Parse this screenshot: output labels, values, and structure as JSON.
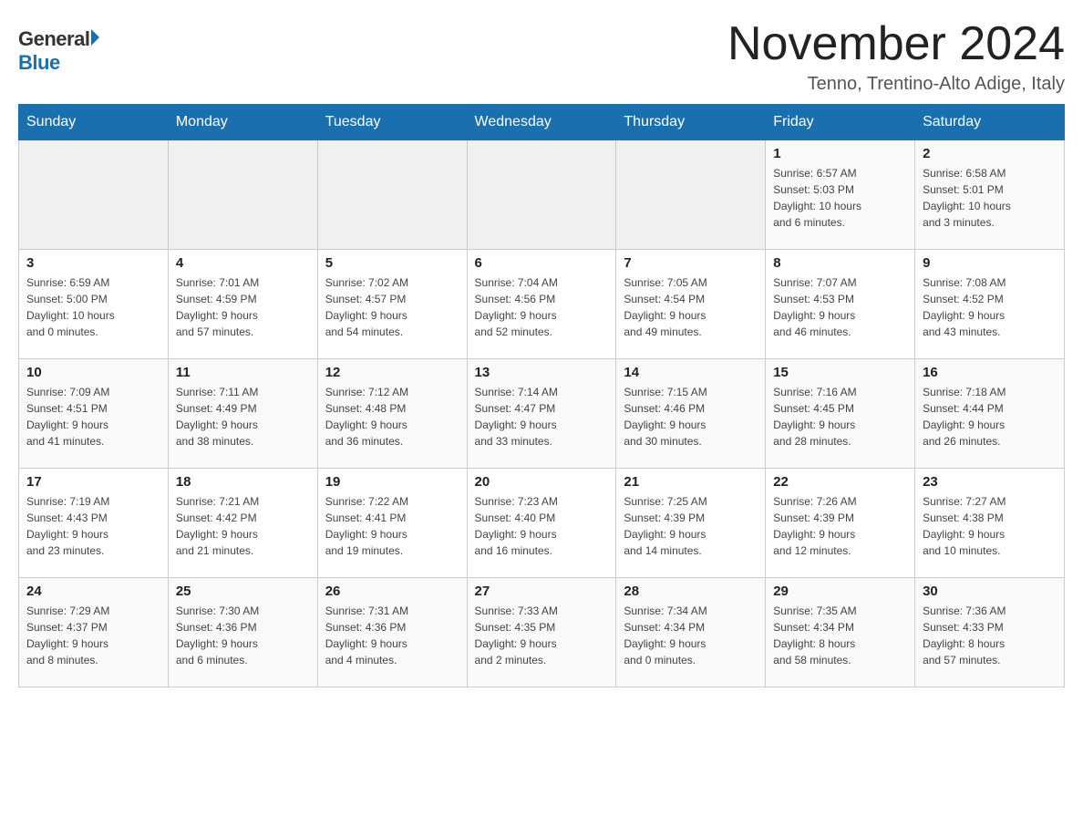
{
  "logo": {
    "general": "General",
    "blue": "Blue"
  },
  "title": "November 2024",
  "location": "Tenno, Trentino-Alto Adige, Italy",
  "days_of_week": [
    "Sunday",
    "Monday",
    "Tuesday",
    "Wednesday",
    "Thursday",
    "Friday",
    "Saturday"
  ],
  "weeks": [
    [
      {
        "day": "",
        "info": ""
      },
      {
        "day": "",
        "info": ""
      },
      {
        "day": "",
        "info": ""
      },
      {
        "day": "",
        "info": ""
      },
      {
        "day": "",
        "info": ""
      },
      {
        "day": "1",
        "info": "Sunrise: 6:57 AM\nSunset: 5:03 PM\nDaylight: 10 hours\nand 6 minutes."
      },
      {
        "day": "2",
        "info": "Sunrise: 6:58 AM\nSunset: 5:01 PM\nDaylight: 10 hours\nand 3 minutes."
      }
    ],
    [
      {
        "day": "3",
        "info": "Sunrise: 6:59 AM\nSunset: 5:00 PM\nDaylight: 10 hours\nand 0 minutes."
      },
      {
        "day": "4",
        "info": "Sunrise: 7:01 AM\nSunset: 4:59 PM\nDaylight: 9 hours\nand 57 minutes."
      },
      {
        "day": "5",
        "info": "Sunrise: 7:02 AM\nSunset: 4:57 PM\nDaylight: 9 hours\nand 54 minutes."
      },
      {
        "day": "6",
        "info": "Sunrise: 7:04 AM\nSunset: 4:56 PM\nDaylight: 9 hours\nand 52 minutes."
      },
      {
        "day": "7",
        "info": "Sunrise: 7:05 AM\nSunset: 4:54 PM\nDaylight: 9 hours\nand 49 minutes."
      },
      {
        "day": "8",
        "info": "Sunrise: 7:07 AM\nSunset: 4:53 PM\nDaylight: 9 hours\nand 46 minutes."
      },
      {
        "day": "9",
        "info": "Sunrise: 7:08 AM\nSunset: 4:52 PM\nDaylight: 9 hours\nand 43 minutes."
      }
    ],
    [
      {
        "day": "10",
        "info": "Sunrise: 7:09 AM\nSunset: 4:51 PM\nDaylight: 9 hours\nand 41 minutes."
      },
      {
        "day": "11",
        "info": "Sunrise: 7:11 AM\nSunset: 4:49 PM\nDaylight: 9 hours\nand 38 minutes."
      },
      {
        "day": "12",
        "info": "Sunrise: 7:12 AM\nSunset: 4:48 PM\nDaylight: 9 hours\nand 36 minutes."
      },
      {
        "day": "13",
        "info": "Sunrise: 7:14 AM\nSunset: 4:47 PM\nDaylight: 9 hours\nand 33 minutes."
      },
      {
        "day": "14",
        "info": "Sunrise: 7:15 AM\nSunset: 4:46 PM\nDaylight: 9 hours\nand 30 minutes."
      },
      {
        "day": "15",
        "info": "Sunrise: 7:16 AM\nSunset: 4:45 PM\nDaylight: 9 hours\nand 28 minutes."
      },
      {
        "day": "16",
        "info": "Sunrise: 7:18 AM\nSunset: 4:44 PM\nDaylight: 9 hours\nand 26 minutes."
      }
    ],
    [
      {
        "day": "17",
        "info": "Sunrise: 7:19 AM\nSunset: 4:43 PM\nDaylight: 9 hours\nand 23 minutes."
      },
      {
        "day": "18",
        "info": "Sunrise: 7:21 AM\nSunset: 4:42 PM\nDaylight: 9 hours\nand 21 minutes."
      },
      {
        "day": "19",
        "info": "Sunrise: 7:22 AM\nSunset: 4:41 PM\nDaylight: 9 hours\nand 19 minutes."
      },
      {
        "day": "20",
        "info": "Sunrise: 7:23 AM\nSunset: 4:40 PM\nDaylight: 9 hours\nand 16 minutes."
      },
      {
        "day": "21",
        "info": "Sunrise: 7:25 AM\nSunset: 4:39 PM\nDaylight: 9 hours\nand 14 minutes."
      },
      {
        "day": "22",
        "info": "Sunrise: 7:26 AM\nSunset: 4:39 PM\nDaylight: 9 hours\nand 12 minutes."
      },
      {
        "day": "23",
        "info": "Sunrise: 7:27 AM\nSunset: 4:38 PM\nDaylight: 9 hours\nand 10 minutes."
      }
    ],
    [
      {
        "day": "24",
        "info": "Sunrise: 7:29 AM\nSunset: 4:37 PM\nDaylight: 9 hours\nand 8 minutes."
      },
      {
        "day": "25",
        "info": "Sunrise: 7:30 AM\nSunset: 4:36 PM\nDaylight: 9 hours\nand 6 minutes."
      },
      {
        "day": "26",
        "info": "Sunrise: 7:31 AM\nSunset: 4:36 PM\nDaylight: 9 hours\nand 4 minutes."
      },
      {
        "day": "27",
        "info": "Sunrise: 7:33 AM\nSunset: 4:35 PM\nDaylight: 9 hours\nand 2 minutes."
      },
      {
        "day": "28",
        "info": "Sunrise: 7:34 AM\nSunset: 4:34 PM\nDaylight: 9 hours\nand 0 minutes."
      },
      {
        "day": "29",
        "info": "Sunrise: 7:35 AM\nSunset: 4:34 PM\nDaylight: 8 hours\nand 58 minutes."
      },
      {
        "day": "30",
        "info": "Sunrise: 7:36 AM\nSunset: 4:33 PM\nDaylight: 8 hours\nand 57 minutes."
      }
    ]
  ]
}
